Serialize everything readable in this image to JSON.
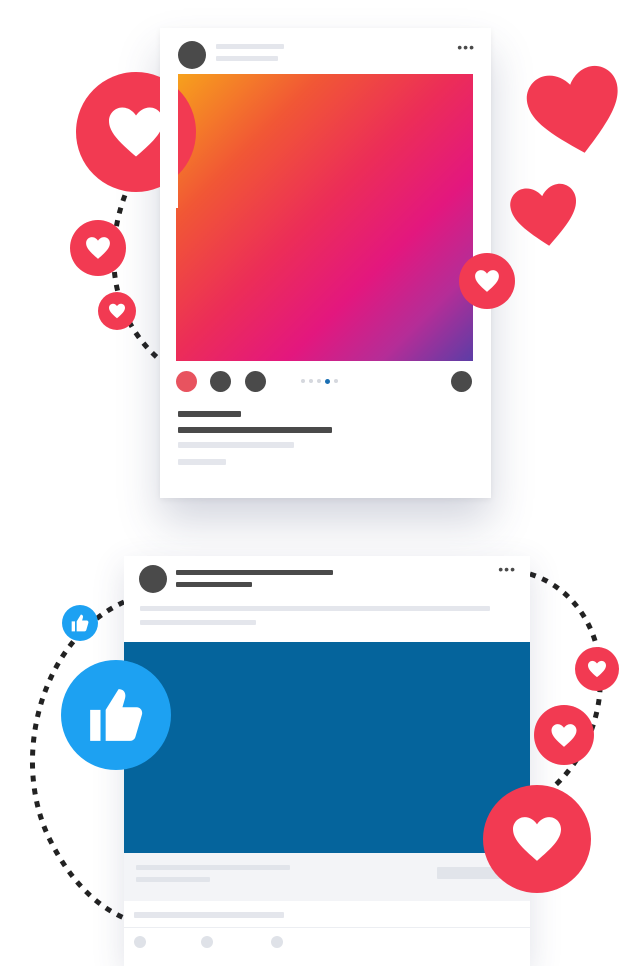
{
  "scene": {
    "top_post": {
      "more_icon": "more-horizontal-icon",
      "photo_gradient": [
        "#f7a21c",
        "#f15735",
        "#ec2d58",
        "#e3177e",
        "#b52d97",
        "#5c3da6"
      ],
      "action_icons": [
        "like-icon",
        "comment-icon",
        "share-icon"
      ],
      "save_icon": "bookmark-icon",
      "carousel_pages": 5,
      "carousel_active": 4
    },
    "bottom_post": {
      "more_icon": "more-horizontal-icon",
      "media_color": "#05649c",
      "reaction_icons": [
        "like-icon",
        "comment-icon",
        "share-icon"
      ]
    },
    "reactions": {
      "heart_color": "#f23a52",
      "like_color": "#1da1f2",
      "icons": [
        "heart-icon",
        "thumbs-up-icon"
      ]
    }
  }
}
